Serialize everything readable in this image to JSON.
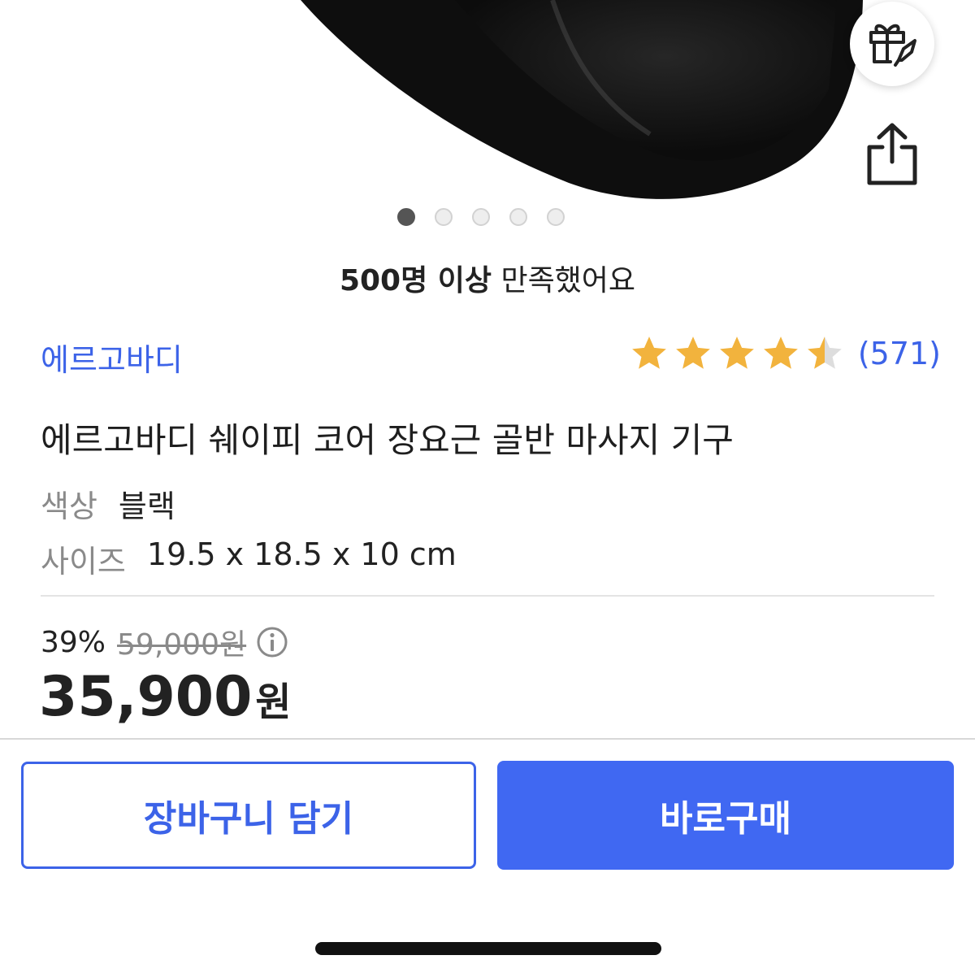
{
  "carousel": {
    "total_slides": 5,
    "active_index": 0
  },
  "satisfaction": {
    "bold": "500명 이상",
    "rest": " 만족했어요"
  },
  "product": {
    "brand": "에르고바디",
    "rating": 4.5,
    "review_count": "(571)",
    "title": "에르고바디 쉐이피 코어 장요근 골반 마사지 기구",
    "specs": {
      "color_label": "색상",
      "color_value": "블랙",
      "size_label": "사이즈",
      "size_value": "19.5 x 18.5 x 10 cm"
    }
  },
  "pricing": {
    "discount_rate": "39%",
    "original_price": "59,000원",
    "sale_price": "35,900",
    "currency_unit": "원"
  },
  "actions": {
    "cart_label": "장바구니 담기",
    "buy_label": "바로구매"
  },
  "icons": {
    "gift": "gift-rocket-icon",
    "share": "share-icon",
    "info": "info-icon",
    "star": "star-icon"
  },
  "colors": {
    "accent": "#3c63e8",
    "buy_button": "#4068f2",
    "star": "#f2b33d",
    "star_empty": "#dddddd"
  }
}
